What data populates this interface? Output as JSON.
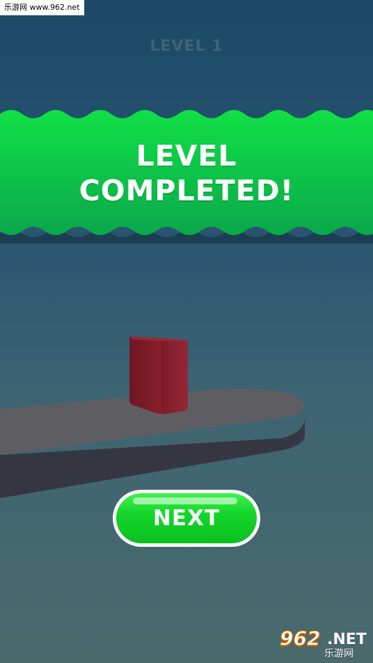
{
  "watermark": {
    "top_text": "乐游网 www.962.net",
    "logo_number": "962",
    "logo_suffix": ".NET",
    "logo_cn": "乐游网"
  },
  "hud": {
    "level_label": "LEVEL 1"
  },
  "banner": {
    "line1": "LEVEL",
    "line2": "COMPLETED!"
  },
  "actions": {
    "next_label": "NEXT"
  },
  "colors": {
    "banner_green": "#0fd63f",
    "banner_green_dark": "#0aa84a",
    "block_red": "#7c1a26",
    "platform_top": "#5f5f63",
    "platform_side": "#3a3a44",
    "next_green": "#14d62a"
  }
}
